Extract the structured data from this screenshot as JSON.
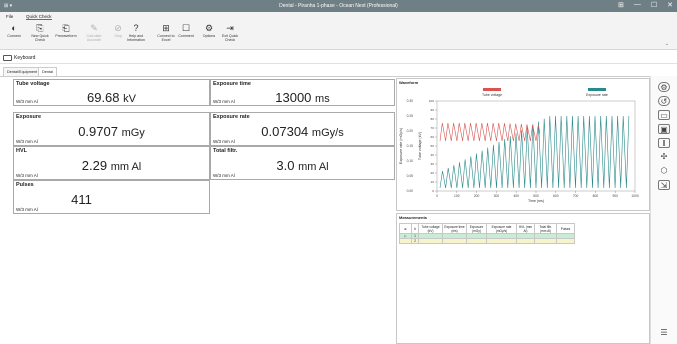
{
  "window": {
    "title": "Dental - Piranha 1-phase - Ocean Next (Professional)",
    "controls": [
      "⊞",
      "—",
      "☐",
      "✕"
    ]
  },
  "menu": {
    "file": "File",
    "quick_check": "Quick Check"
  },
  "ribbon": {
    "buttons": [
      {
        "label": "Connect",
        "icon": "connect-icon",
        "glyph": "◐"
      },
      {
        "label": "New Quick Check",
        "icon": "new-check-icon",
        "glyph": "⎘"
      },
      {
        "label": "Prewaveform",
        "icon": "prewaveform-icon",
        "glyph": "⎗"
      },
      {
        "label": "Calculate Accurate",
        "icon": "calculate-icon",
        "glyph": "✎"
      },
      {
        "label": "Stop",
        "icon": "stop-icon",
        "glyph": "⊘"
      },
      {
        "label": "Help and Information",
        "icon": "help-icon",
        "glyph": "?"
      },
      {
        "label": "Connect to Excel",
        "icon": "excel-icon",
        "glyph": "⊞"
      },
      {
        "label": "Comment",
        "icon": "comment-icon",
        "glyph": "☐"
      },
      {
        "label": "Options",
        "icon": "options-icon",
        "glyph": "⚙"
      },
      {
        "label": "Exit Quick Check",
        "icon": "exit-icon",
        "glyph": "⇥"
      }
    ]
  },
  "toolbar": {
    "keyboard": "Keyboard"
  },
  "tabs": [
    "Dental/Equipment",
    "Dental"
  ],
  "panels": [
    {
      "title": "Tube voltage",
      "value": "69.68",
      "unit": "kV",
      "foot": "W/3 mm Al"
    },
    {
      "title": "Exposure time",
      "value": "13000",
      "unit": "ms",
      "foot": "W/3 mm Al"
    },
    {
      "title": "Exposure",
      "value": "0.9707",
      "unit": "mGy",
      "foot": "W/3 mm Al"
    },
    {
      "title": "Exposure rate",
      "value": "0.07304",
      "unit": "mGy/s",
      "foot": "W/3 mm Al"
    },
    {
      "title": "HVL",
      "value": "2.29",
      "unit": "mm Al",
      "foot": "W/3 mm Al"
    },
    {
      "title": "Total filtr.",
      "value": "3.0",
      "unit": "mm Al",
      "foot": "W/3 mm Al"
    },
    {
      "title": "Pulses",
      "value": "411",
      "unit": "",
      "foot": "W/3 mm Al"
    }
  ],
  "waveform": {
    "title": "Waveform",
    "chart_data": {
      "type": "line",
      "xlabel": "Time (ms)",
      "ylabel_left": "Exposure rate (mGy/s)",
      "ylabel_right": "Tube voltage (kV)",
      "series": [
        {
          "name": "Tube voltage",
          "color": "#d9534f"
        },
        {
          "name": "Exposure rate",
          "color": "#2a8a8a"
        }
      ],
      "x_ticks": [
        "0",
        "100",
        "200",
        "300",
        "400",
        "500",
        "600",
        "700",
        "800",
        "900",
        "1000"
      ],
      "y_left_ticks": [
        "0.30",
        "0.25",
        "0.20",
        "0.15",
        "0.10",
        "0.05",
        "0.00"
      ],
      "y_right_ticks": [
        "100",
        "90",
        "80",
        "70",
        "60",
        "50",
        "40",
        "30",
        "20",
        "10",
        "0"
      ],
      "xlim": [
        0,
        1000
      ],
      "ylim_left": [
        0,
        0.3
      ],
      "ylim_right": [
        0,
        100
      ]
    }
  },
  "measurements": {
    "title": "Measurements",
    "columns": [
      "#",
      "Tube voltage (kV)",
      "Exposure time (ms)",
      "Exposure (mGy)",
      "Exposure rate (mGy/s)",
      "HVL (mm Al)",
      "Total filtr. (mm Al)",
      "Pulses"
    ],
    "rows": [
      [
        "1",
        "",
        "",
        "",
        "",
        "",
        "",
        ""
      ],
      [
        "2",
        "",
        "",
        "",
        "",
        "",
        "",
        ""
      ]
    ]
  },
  "rightbar": [
    "settings-icon",
    "reset-icon",
    "waveform-view-icon",
    "layout-icon",
    "compare-icon",
    "expand-icon",
    "tag-icon",
    "export-icon",
    "list-icon"
  ]
}
